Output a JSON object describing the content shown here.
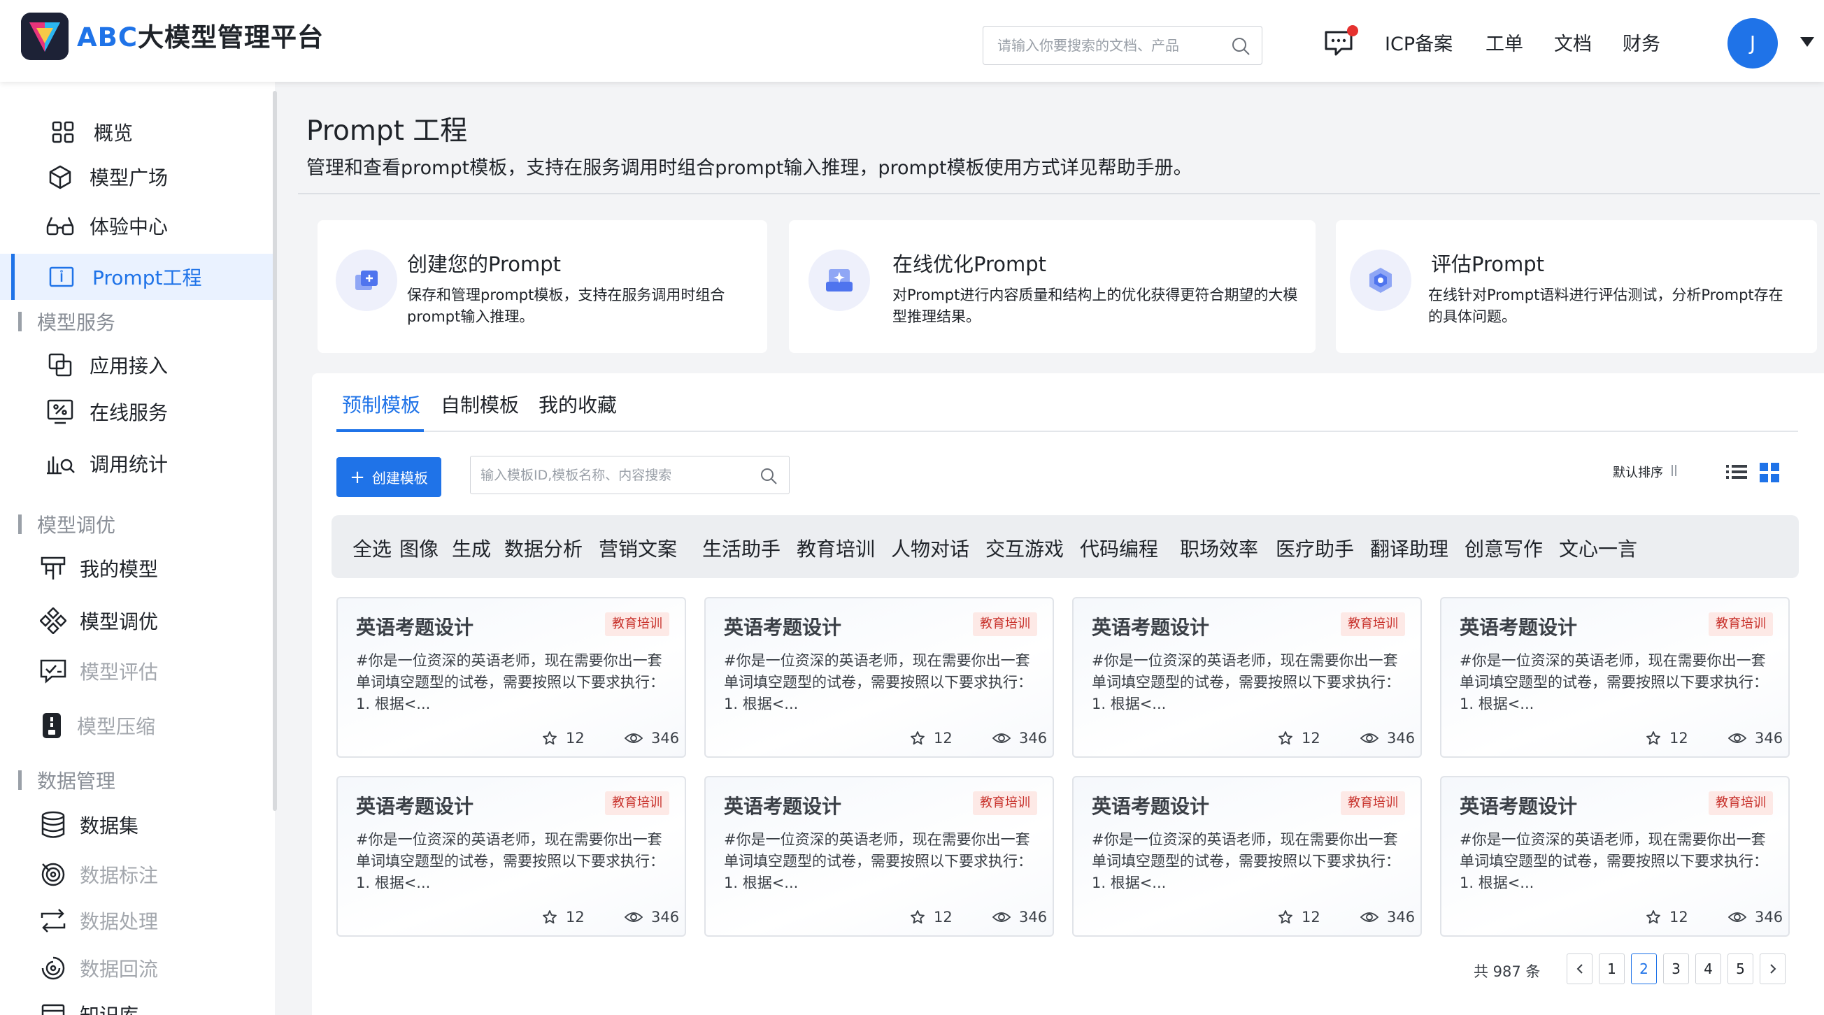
{
  "header": {
    "logo_accent": "ABC",
    "logo_rest": "大模型管理平台",
    "search_placeholder": "请输入你要搜索的文档、产品",
    "nav": [
      "ICP备案",
      "工单",
      "文档",
      "财务"
    ],
    "avatar_initial": "J"
  },
  "sidebar": {
    "items_top": [
      {
        "label": "概览",
        "icon": "overview-grid-icon"
      },
      {
        "label": "模型广场",
        "icon": "model-cube-icon"
      },
      {
        "label": "体验中心",
        "icon": "glasses-icon"
      },
      {
        "label": "Prompt工程",
        "icon": "prompt-icon",
        "active": true
      }
    ],
    "group_service": "模型服务",
    "items_service": [
      {
        "label": "应用接入",
        "icon": "app-access-icon"
      },
      {
        "label": "在线服务",
        "icon": "online-service-icon"
      },
      {
        "label": "调用统计",
        "icon": "call-stats-icon"
      }
    ],
    "group_tuning": "模型调优",
    "items_tuning": [
      {
        "label": "我的模型",
        "icon": "my-model-icon"
      },
      {
        "label": "模型调优",
        "icon": "model-tuning-icon"
      },
      {
        "label": "模型评估",
        "icon": "model-eval-icon",
        "muted": true
      },
      {
        "label": "模型压缩",
        "icon": "model-compress-icon",
        "muted": true
      }
    ],
    "group_data": "数据管理",
    "items_data": [
      {
        "label": "数据集",
        "icon": "database-icon"
      },
      {
        "label": "数据标注",
        "icon": "data-label-icon",
        "muted": true
      },
      {
        "label": "数据处理",
        "icon": "data-process-icon",
        "muted": true
      },
      {
        "label": "数据回流",
        "icon": "data-reflow-icon",
        "muted": true
      },
      {
        "label": "知识库",
        "icon": "knowledge-icon"
      }
    ]
  },
  "page": {
    "title": "Prompt 工程",
    "description": "管理和查看prompt模板，支持在服务调用时组合prompt输入推理，prompt模板使用方式详见帮助手册。"
  },
  "features": [
    {
      "title": "创建您的Prompt",
      "desc": "保存和管理prompt模板，支持在服务调用时组合prompt输入推理。",
      "icon": "create-prompt-icon"
    },
    {
      "title": "在线优化Prompt",
      "desc": "对Prompt进行内容质量和结构上的优化获得更符合期望的大模型推理结果。",
      "icon": "optimize-prompt-icon"
    },
    {
      "title": "评估Prompt",
      "desc": "在线针对Prompt语料进行评估测试，分析Prompt存在的具体问题。",
      "icon": "evaluate-prompt-icon"
    }
  ],
  "tabs": [
    "预制模板",
    "自制模板",
    "我的收藏"
  ],
  "toolbar": {
    "create_label": "创建模板",
    "search_placeholder": "输入模板ID,模板名称、内容搜索",
    "sort_label": "默认排序"
  },
  "categories": [
    "全选",
    "图像",
    "生成",
    "数据分析",
    "营销文案",
    "生活助手",
    "教育培训",
    "人物对话",
    "交互游戏",
    "代码编程",
    "职场效率",
    "医疗助手",
    "翻译助理",
    "创意写作",
    "文心一言"
  ],
  "cards": [
    {
      "title": "英语考题设计",
      "tag": "教育培训",
      "body": "#你是一位资深的英语老师，现在需要你出一套单词填空题型的试卷，需要按照以下要求执行： 1. 根据<...",
      "stars": "12",
      "views": "346"
    },
    {
      "title": "英语考题设计",
      "tag": "教育培训",
      "body": "#你是一位资深的英语老师，现在需要你出一套单词填空题型的试卷，需要按照以下要求执行： 1. 根据<...",
      "stars": "12",
      "views": "346"
    },
    {
      "title": "英语考题设计",
      "tag": "教育培训",
      "body": "#你是一位资深的英语老师，现在需要你出一套单词填空题型的试卷，需要按照以下要求执行： 1. 根据<...",
      "stars": "12",
      "views": "346"
    },
    {
      "title": "英语考题设计",
      "tag": "教育培训",
      "body": "#你是一位资深的英语老师，现在需要你出一套单词填空题型的试卷，需要按照以下要求执行： 1. 根据<...",
      "stars": "12",
      "views": "346"
    },
    {
      "title": "英语考题设计",
      "tag": "教育培训",
      "body": "#你是一位资深的英语老师，现在需要你出一套单词填空题型的试卷，需要按照以下要求执行： 1. 根据<...",
      "stars": "12",
      "views": "346"
    },
    {
      "title": "英语考题设计",
      "tag": "教育培训",
      "body": "#你是一位资深的英语老师，现在需要你出一套单词填空题型的试卷，需要按照以下要求执行： 1. 根据<...",
      "stars": "12",
      "views": "346"
    },
    {
      "title": "英语考题设计",
      "tag": "教育培训",
      "body": "#你是一位资深的英语老师，现在需要你出一套单词填空题型的试卷，需要按照以下要求执行： 1. 根据<...",
      "stars": "12",
      "views": "346"
    },
    {
      "title": "英语考题设计",
      "tag": "教育培训",
      "body": "#你是一位资深的英语老师，现在需要你出一套单词填空题型的试卷，需要按照以下要求执行： 1. 根据<...",
      "stars": "12",
      "views": "346"
    }
  ],
  "pagination": {
    "total": "共 987 条",
    "pages": [
      "1",
      "2",
      "3",
      "4",
      "5"
    ],
    "current": "2"
  },
  "colors": {
    "accent": "#1f73e8",
    "tag_bg": "#fde9e6",
    "tag_text": "#c8322c",
    "notification_dot": "#e5312f"
  }
}
